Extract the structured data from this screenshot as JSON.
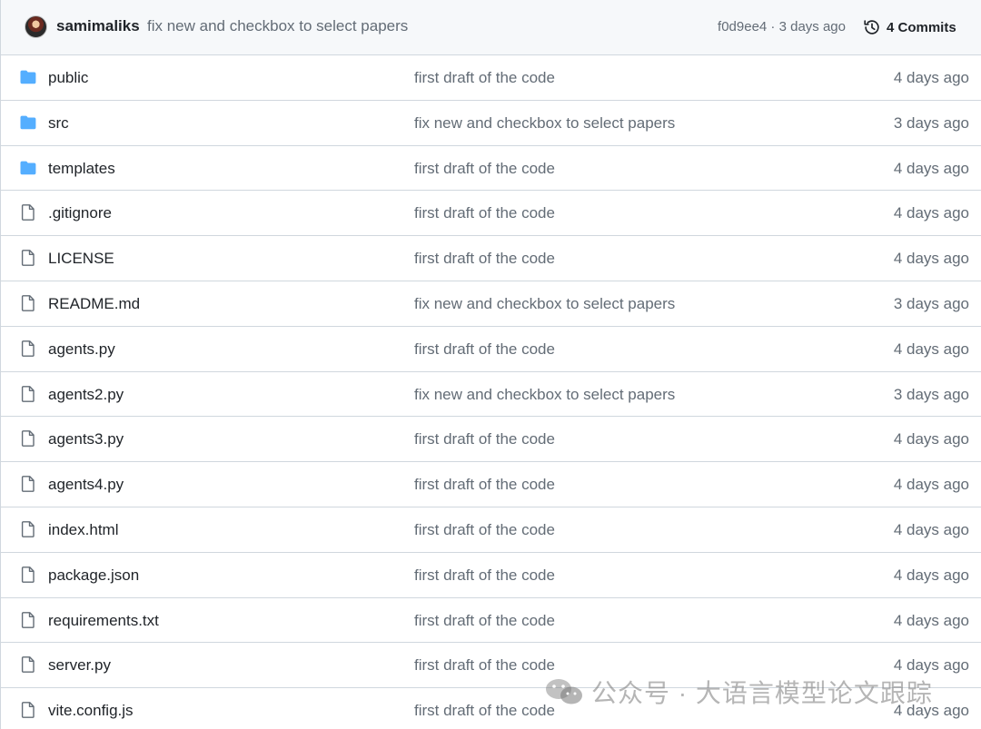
{
  "header": {
    "author": "samimaliks",
    "commit_message": "fix new and checkbox to select papers",
    "commit_meta": "f0d9ee4 · 3 days ago",
    "commits_label": "4 Commits"
  },
  "files": [
    {
      "type": "folder",
      "name": "public",
      "message": "first draft of the code",
      "age": "4 days ago"
    },
    {
      "type": "folder",
      "name": "src",
      "message": "fix new and checkbox to select papers",
      "age": "3 days ago"
    },
    {
      "type": "folder",
      "name": "templates",
      "message": "first draft of the code",
      "age": "4 days ago"
    },
    {
      "type": "file",
      "name": ".gitignore",
      "message": "first draft of the code",
      "age": "4 days ago"
    },
    {
      "type": "file",
      "name": "LICENSE",
      "message": "first draft of the code",
      "age": "4 days ago"
    },
    {
      "type": "file",
      "name": "README.md",
      "message": "fix new and checkbox to select papers",
      "age": "3 days ago"
    },
    {
      "type": "file",
      "name": "agents.py",
      "message": "first draft of the code",
      "age": "4 days ago"
    },
    {
      "type": "file",
      "name": "agents2.py",
      "message": "fix new and checkbox to select papers",
      "age": "3 days ago"
    },
    {
      "type": "file",
      "name": "agents3.py",
      "message": "first draft of the code",
      "age": "4 days ago"
    },
    {
      "type": "file",
      "name": "agents4.py",
      "message": "first draft of the code",
      "age": "4 days ago"
    },
    {
      "type": "file",
      "name": "index.html",
      "message": "first draft of the code",
      "age": "4 days ago"
    },
    {
      "type": "file",
      "name": "package.json",
      "message": "first draft of the code",
      "age": "4 days ago"
    },
    {
      "type": "file",
      "name": "requirements.txt",
      "message": "first draft of the code",
      "age": "4 days ago"
    },
    {
      "type": "file",
      "name": "server.py",
      "message": "first draft of the code",
      "age": "4 days ago"
    },
    {
      "type": "file",
      "name": "vite.config.js",
      "message": "first draft of the code",
      "age": "4 days ago"
    }
  ],
  "watermark": {
    "text": "公众号 · 大语言模型论文跟踪"
  },
  "colors": {
    "folder": "#54aeff",
    "file_outline": "#636c76",
    "muted_text": "#636c76",
    "border": "#d0d7de",
    "header_bg": "#f6f8fa"
  }
}
